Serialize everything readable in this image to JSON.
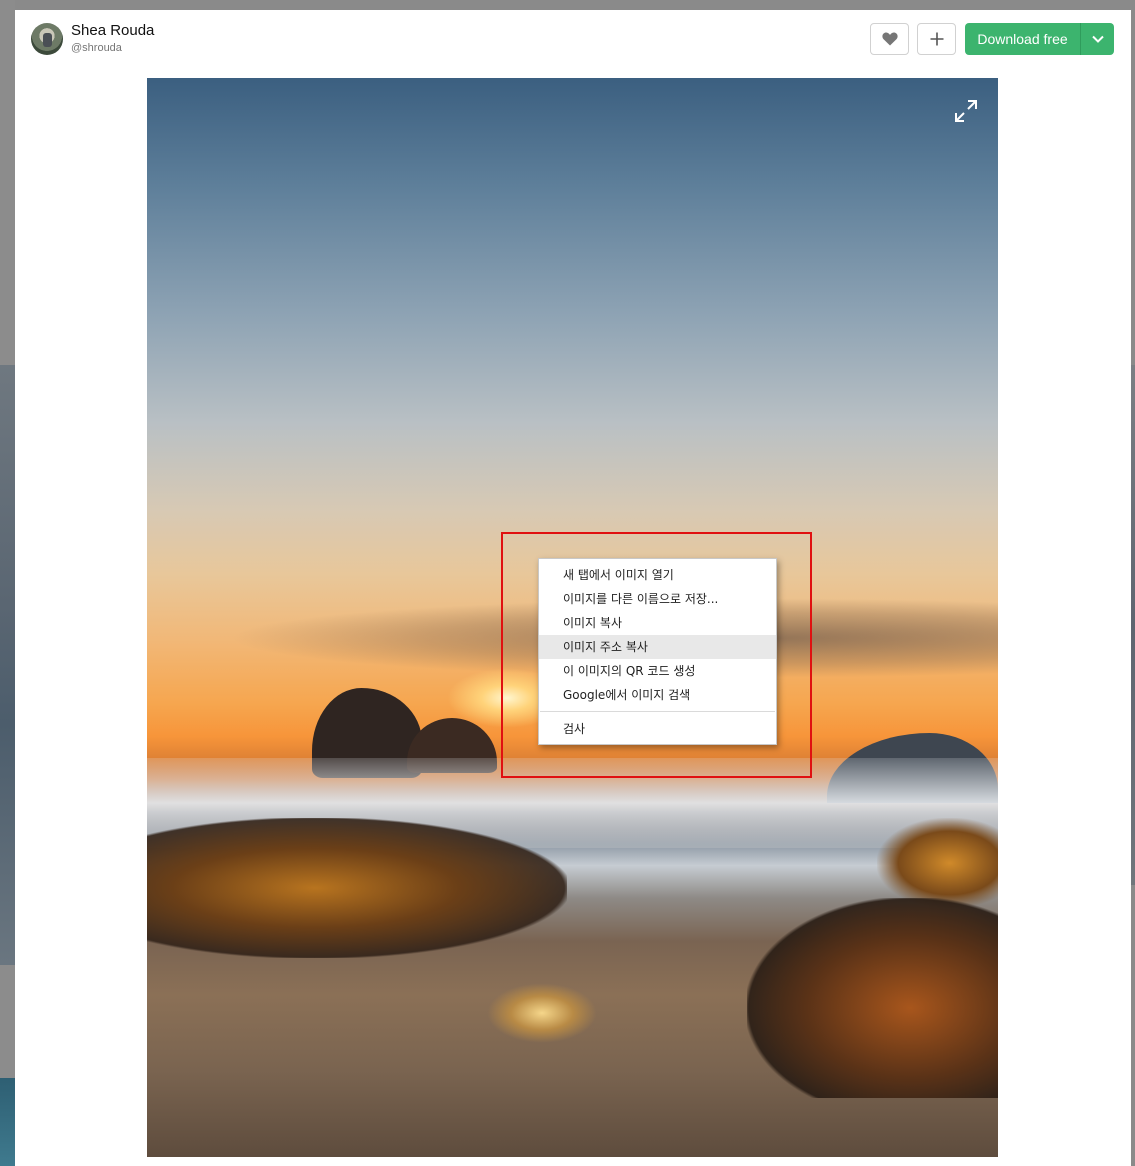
{
  "author": {
    "name": "Shea Rouda",
    "handle": "@shrouda"
  },
  "actions": {
    "like_icon": "heart-icon",
    "add_icon": "plus-icon",
    "download_label": "Download free",
    "download_menu_icon": "chevron-down-icon"
  },
  "photo": {
    "expand_icon": "expand-icon"
  },
  "context_menu": {
    "items": [
      "새 탭에서 이미지 열기",
      "이미지를 다른 이름으로 저장...",
      "이미지 복사",
      "이미지 주소 복사",
      "이 이미지의 QR 코드 생성",
      "Google에서 이미지 검색"
    ],
    "hovered_index": 3,
    "inspect": "검사"
  },
  "colors": {
    "download_green": "#3cb46e",
    "highlight_red": "#e01010"
  }
}
